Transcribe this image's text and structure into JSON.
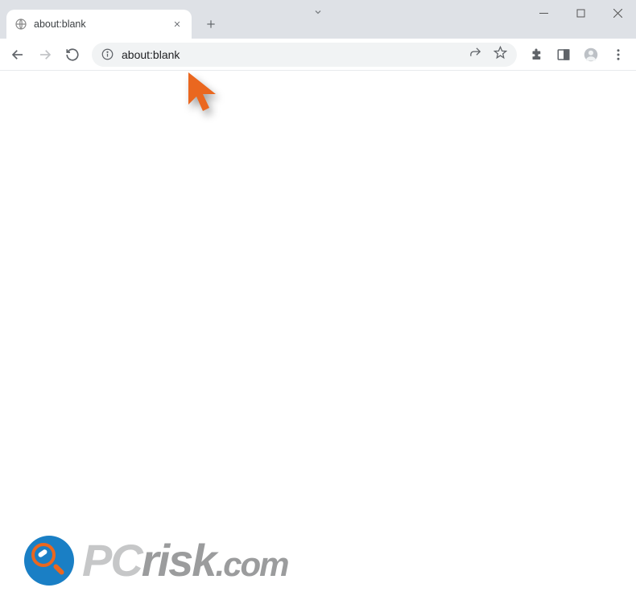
{
  "tab": {
    "title": "about:blank"
  },
  "address_bar": {
    "url": "about:blank"
  },
  "watermark": {
    "pc": "PC",
    "risk": "risk",
    "domain": ".com"
  }
}
